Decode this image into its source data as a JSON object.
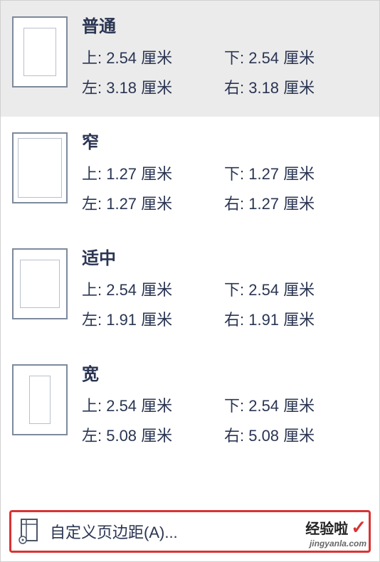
{
  "options": [
    {
      "title": "普通",
      "top": "上: 2.54 厘米",
      "bottom": "下: 2.54 厘米",
      "left": "左: 3.18 厘米",
      "right": "右: 3.18 厘米"
    },
    {
      "title": "窄",
      "top": "上: 1.27 厘米",
      "bottom": "下: 1.27 厘米",
      "left": "左: 1.27 厘米",
      "right": "右: 1.27 厘米"
    },
    {
      "title": "适中",
      "top": "上: 2.54 厘米",
      "bottom": "下: 2.54 厘米",
      "left": "左: 1.91 厘米",
      "right": "右: 1.91 厘米"
    },
    {
      "title": "宽",
      "top": "上: 2.54 厘米",
      "bottom": "下: 2.54 厘米",
      "left": "左: 5.08 厘米",
      "right": "右: 5.08 厘米"
    }
  ],
  "custom_label": "自定义页边距(A)...",
  "watermark": {
    "title": "经验啦",
    "url": "jingyanla.com"
  }
}
